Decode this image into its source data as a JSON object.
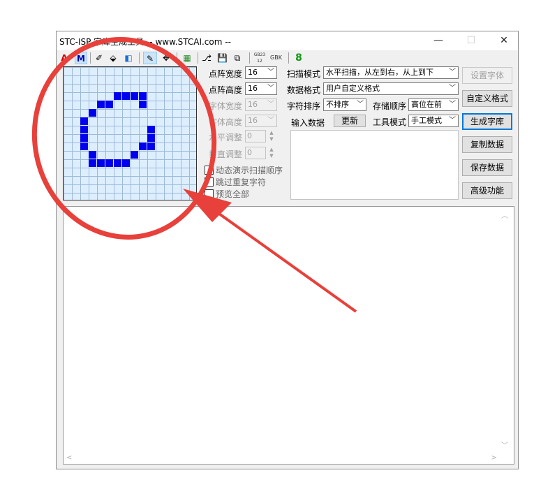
{
  "window": {
    "title": "STC-ISP 字库生成工具 -- www.STCAI.com --",
    "minimize": "—",
    "maximize": "☐",
    "close": "✕"
  },
  "toolbar": {
    "items": [
      "A",
      "M",
      "✐",
      "⬙",
      "◧",
      "✎",
      "✥",
      "▦",
      "⎇",
      "💾",
      "⧉",
      "GB2312",
      "GBK",
      "8"
    ],
    "icons": [
      "font-icon",
      "mode-icon",
      "eraser-icon",
      "fill-icon",
      "color-icon",
      "pencil-icon",
      "move-icon",
      "palette-icon",
      "open-icon",
      "save-icon",
      "save-as-icon",
      "gb2312-icon",
      "gbk-icon",
      "digit-icon"
    ]
  },
  "grid": {
    "size": 16,
    "cells": [
      [
        3,
        6
      ],
      [
        3,
        7
      ],
      [
        3,
        8
      ],
      [
        3,
        9
      ],
      [
        4,
        4
      ],
      [
        4,
        5
      ],
      [
        4,
        9
      ],
      [
        5,
        3
      ],
      [
        6,
        2
      ],
      [
        7,
        2
      ],
      [
        7,
        10
      ],
      [
        8,
        2
      ],
      [
        8,
        10
      ],
      [
        9,
        2
      ],
      [
        9,
        9
      ],
      [
        9,
        10
      ],
      [
        10,
        3
      ],
      [
        10,
        8
      ],
      [
        11,
        3
      ],
      [
        11,
        4
      ],
      [
        11,
        5
      ],
      [
        11,
        6
      ],
      [
        11,
        7
      ]
    ],
    "fill_color": "#0000ee"
  },
  "left_settings": {
    "dot_width_label": "点阵宽度",
    "dot_width_value": "16",
    "dot_height_label": "点阵高度",
    "dot_height_value": "16",
    "font_width_label": "字体宽度",
    "font_width_value": "16",
    "font_height_label": "字体高度",
    "font_height_value": "16",
    "h_adjust_label": "水平调整",
    "h_adjust_value": "0",
    "v_adjust_label": "垂直调整",
    "v_adjust_value": "0",
    "check_animate": "动态演示扫描顺序",
    "check_skip": "跳过重复字符",
    "check_preview": "预览全部"
  },
  "right_settings": {
    "scan_mode_label": "扫描模式",
    "scan_mode_value": "水平扫描，从左到右，从上到下",
    "data_format_label": "数据格式",
    "data_format_value": "用户自定义格式",
    "char_sort_label": "字符排序",
    "char_sort_value": "不排序",
    "storage_order_label": "存储顺序",
    "storage_order_value": "高位在前",
    "input_data_label": "输入数据",
    "update_button": "更新",
    "tool_mode_label": "工具模式",
    "tool_mode_value": "手工模式"
  },
  "buttons": {
    "set_font": "设置字体",
    "custom_format": "自定义格式",
    "generate": "生成字库",
    "copy_data": "复制数据",
    "save_data": "保存数据",
    "advanced": "高级功能"
  },
  "annotation": {
    "color": "#e8403a"
  }
}
